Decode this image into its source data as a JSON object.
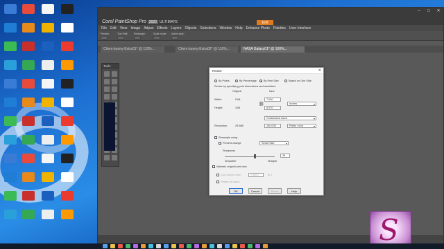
{
  "desktop": {
    "icons": [
      {
        "label": "",
        "color": "#3a7bd5"
      },
      {
        "label": "",
        "color": "#e84a3b"
      },
      {
        "label": "",
        "color": "#f5f5f5"
      },
      {
        "label": "",
        "color": "#222"
      },
      {
        "label": "",
        "color": "#1f7dd6"
      },
      {
        "label": "",
        "color": "#e8891b"
      },
      {
        "label": "",
        "color": "#f0b400"
      },
      {
        "label": "",
        "color": "#ffffff"
      },
      {
        "label": "",
        "color": "#3cba54"
      },
      {
        "label": "",
        "color": "#c9302c"
      },
      {
        "label": "",
        "color": "#1b5fbf"
      },
      {
        "label": "",
        "color": "#ea3b2e"
      },
      {
        "label": "",
        "color": "#2aa0db"
      },
      {
        "label": "",
        "color": "#34a853"
      },
      {
        "label": "",
        "color": "#eeeeee"
      },
      {
        "label": "",
        "color": "#ff9900"
      }
    ]
  },
  "psp": {
    "title": "Corel PaintShop Pro",
    "title_badge": "2020",
    "title_suffix": "ULTIMATE",
    "tab_edit": "Edit",
    "window_controls": [
      "–",
      "□",
      "✕"
    ],
    "menu": [
      "File",
      "Edit",
      "View",
      "Image",
      "Adjust",
      "Effects",
      "Layers",
      "Objects",
      "Selections",
      "Window",
      "Help",
      "Enhance Photo",
      "Palettes",
      "User Interface"
    ],
    "toolbar_labels": [
      "Presets:",
      "Tool Shift:",
      "Rectangle:",
      "Scale mode:",
      "Active style:"
    ],
    "doc_tabs": [
      "Chem-bunny-Extra01* @ 110%...",
      "Chem-bunny-Extra02* @ 110%...",
      "NASA Galaxy01* @ 100%..."
    ],
    "tools_header": "Tools"
  },
  "dialog": {
    "title": "Resize",
    "close": "✕",
    "modes": [
      "By Pixels",
      "By Percentage",
      "By Print Size",
      "Based on One Side"
    ],
    "hint": "Resize by specifying print dimensions and resolution.",
    "col_original": "Original",
    "col_new": "New",
    "width_label": "Width:",
    "width_original": "5.68",
    "width_new": "7.500",
    "height_label": "Height:",
    "height_original": "3.84",
    "height_new": "5.070",
    "units": "Inches",
    "size_preset": "Customized sized",
    "resolution_label": "Resolution:",
    "resolution_original": "29.988",
    "resolution_new": "100.000",
    "resolution_units": "Pixels / inch",
    "resample_label": "Resample using",
    "resample_value": "Smart Size",
    "percent_label": "Percent change",
    "percent_value": "36",
    "sharpness_label": "Sharpness",
    "smoother_label": "Smoother",
    "sharper_label": "Sharper",
    "maintain_label": "Maintain original print size",
    "lock_label": "Lock aspect ratio:",
    "lock_value": "1.4800",
    "lock_suffix": "to 1",
    "resize_layers_label": "Resize all layers",
    "ok": "OK",
    "cancel": "Cancel",
    "reset": "Reset",
    "help": "Help",
    "selected_mode_index": 2,
    "resample_checked": true,
    "percent_checked": true,
    "maintain_checked": true,
    "sharpness_level": 0.6
  },
  "colors": {
    "accent": "#e07a1f",
    "dialog_bg": "#f0f0f0",
    "app_bg": "#595959"
  }
}
